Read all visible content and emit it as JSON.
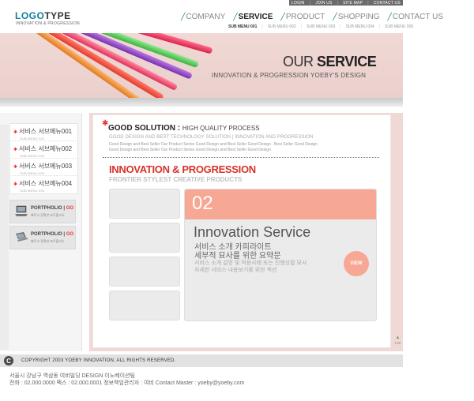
{
  "top_links": [
    "LOGIN",
    "JOIN US",
    "SITE MAP",
    "CONTACT US"
  ],
  "logo": {
    "part1": "LOGO",
    "part2": "TYPE",
    "tagline": "INNOVATION & PROGRESSION"
  },
  "nav": {
    "items": [
      "COMPANY",
      "SERVICE",
      "PRODUCT",
      "SHOPPING",
      "CONTACT US"
    ],
    "active": "SERVICE",
    "sub_items": [
      "SUB MENU 001",
      "SUB MENU 002",
      "SUB MENU 003",
      "SUB MENU 004",
      "SUB MENU 005"
    ]
  },
  "banner": {
    "title_light": "OUR",
    "title_bold": "SERVICE",
    "subtitle": "INNOVATION & PROGRESSION YOEBY'S DESIGN"
  },
  "left_menu": [
    {
      "label": "서비스 서브메뉴001",
      "sub": "SUB MENU 001"
    },
    {
      "label": "서비스 서브메뉴002",
      "sub": "SUB MENU 002"
    },
    {
      "label": "서비스 서브메뉴003",
      "sub": "SUB MENU 003"
    },
    {
      "label": "서비스 서브메뉴004",
      "sub": "SUB MENU 004"
    }
  ],
  "portfolio": [
    {
      "title": "PORTPHOLIO",
      "code": "GO",
      "sub": "빠르고 정확한 포트폴리오"
    },
    {
      "title": "PORTPHOLIO",
      "code": "GO",
      "sub": "빠르고 정확한 포트폴리오"
    }
  ],
  "content": {
    "gs_title": "GOOD SOLUTION :",
    "gs_title_sub": "HIGH QUALITY PROCESS",
    "gs_sub": "GOOD DESIGN AND BEST TECHNOLOGY SOLUTION | INNOVATION AND PROGRESSION",
    "gs_desc1": "Good Design and Best Seller Our Product Series Good Design and Best Seller Good Design . Best Seller Good Design",
    "gs_desc2": "Good Design and Best Seller Our Product Series Good Design and Best Seller Good Design",
    "ip_title": "INNOVATION & PROGRESSION",
    "ip_sub": "FRONTIER STYLEST CREATIVE PRODUCTS"
  },
  "service": {
    "number": "02",
    "title": "Innovation Service",
    "kr1": "서비스 소개 카피라이트",
    "kr2": "세부적 묘사를 위한 요약문",
    "desc1": "서비스 소개 설명 및 적용사례 또는 진행상황 묘사",
    "desc2": "자세한 서비스 내용보기를 위한 섹션",
    "view_label": "VIEW"
  },
  "top_button": "TOP",
  "footer": {
    "copy_symbol": "C",
    "copyright": "COPYRIGHT 2003 YOEBY INNOVATION. ALL RIGHTS RESERVED.",
    "address": "서울시 강남구 역삼동 여비빌딩 DESIGN 이노베이션팀",
    "tel": "전화 : 02.000.0000  팩스 : 02.000.0001  정보책임관리자 : 여비 Contact Master : yoeby@yoeby.com"
  },
  "colors": {
    "brand": "#0e7f9c",
    "accent_red": "#d8322a",
    "salmon": "#f7a894",
    "pink_bg": "#f0d8d5"
  }
}
